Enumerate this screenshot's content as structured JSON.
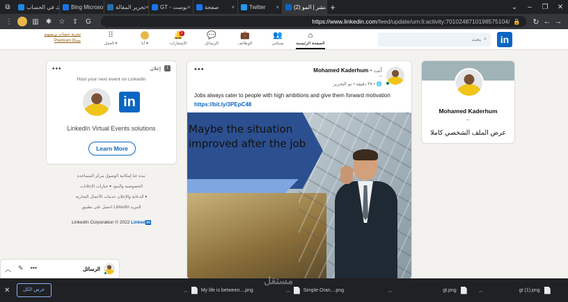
{
  "browser": {
    "tabs": [
      {
        "title": "اشترك في الحساب",
        "color": "#1e88e5"
      },
      {
        "title": "Bing Microso...",
        "color": "#1a73e8"
      },
      {
        "title": "تحرير المقالة",
        "color": "#2271b1"
      },
      {
        "title": "GT - بوست",
        "color": "#1a73e8"
      },
      {
        "title": "صفحة ",
        "color": "#1877f2"
      },
      {
        "title": "Twitter",
        "color": "#1d9bf0"
      },
      {
        "title": "(2) نشر | المو...",
        "color": "#0a66c2"
      }
    ],
    "url_host": "https://www.linkedin.com",
    "url_path": "/feed/update/urn:li:activity:7010248710198575104/"
  },
  "nav": {
    "search_placeholder": "بحث",
    "logo": "in",
    "items": [
      {
        "label": "الصفحة الرئيسية",
        "icon": "home-icon"
      },
      {
        "label": "شبكتي",
        "icon": "network-icon"
      },
      {
        "label": "الوظائف",
        "icon": "briefcase-icon"
      },
      {
        "label": "الرسائل",
        "icon": "chat-icon"
      },
      {
        "label": "الإشعارات",
        "icon": "bell-icon",
        "badge": "2"
      },
      {
        "label": "أنا",
        "icon": "me-avatar"
      },
      {
        "label": "العمل",
        "icon": "grid-icon"
      }
    ],
    "premium": "تجربة حساب بريميوم Premium مجانًا"
  },
  "profile": {
    "name": "Mohamed Kaderhum",
    "subtitle": "--",
    "view_full": "عرض الملف الشخصي كاملا"
  },
  "post": {
    "author": "Mohamed Kaderhum",
    "degree": "• أنت",
    "headline": "--",
    "meta": "٣٧ دقيقة • تم التحرير •",
    "text": "Jobs always cater to people with high ambitions and give them forward motivation",
    "link": "https://bit.ly/3PEpC48",
    "image_caption": "Maybe the situation improved after the job"
  },
  "ad": {
    "label": "إعلان",
    "host_line": "Host your next event on LinkedIn",
    "solutions": "LinkedIn Virtual Events solutions",
    "cta": "Learn More",
    "logo": "in"
  },
  "footer": {
    "line1": "نبذة عنا    إمكانية الوصول    مركز المساعدة",
    "line2": "الخصوصية والبنود ▾    خيارات الإعلانات",
    "line3": "الدعاية والإعلان    خدمات الأعمال التجارية ▾",
    "line4": "احصل على تطبيق LinkedIn    المزيد",
    "copyright": "LinkedIn Corporation © 2022",
    "brand": "Linked"
  },
  "messaging": {
    "label": "الرسائل"
  },
  "downloads": {
    "show_all": "عرض الكل",
    "items": [
      "My life is between....png",
      "Simple Oran....png",
      "gt.png",
      "gt (1).png"
    ]
  },
  "watermark": "مستقل"
}
